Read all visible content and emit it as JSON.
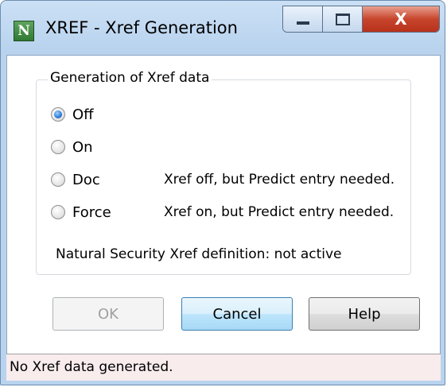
{
  "window": {
    "title": "XREF - Xref Generation",
    "app_icon_letter": "N",
    "icons": {
      "app": "natural-app-icon",
      "minimize": "minimize-icon",
      "maximize": "maximize-icon",
      "close": "close-icon"
    },
    "close_glyph": "X"
  },
  "group": {
    "legend": "Generation of Xref data",
    "options": [
      {
        "label": "Off",
        "checked": true,
        "description": ""
      },
      {
        "label": "On",
        "checked": false,
        "description": ""
      },
      {
        "label": "Doc",
        "checked": false,
        "description": "Xref off, but Predict entry needed."
      },
      {
        "label": "Force",
        "checked": false,
        "description": "Xref on, but Predict entry needed."
      }
    ],
    "security_status": "Natural Security Xref definition: not active"
  },
  "buttons": {
    "ok": "OK",
    "cancel": "Cancel",
    "help": "Help",
    "ok_enabled": false
  },
  "statusbar": {
    "text": "No Xref data generated."
  },
  "colors": {
    "accent": "#2c7ad6",
    "close": "#c8452d",
    "statusbar_bg": "#f8eced"
  }
}
